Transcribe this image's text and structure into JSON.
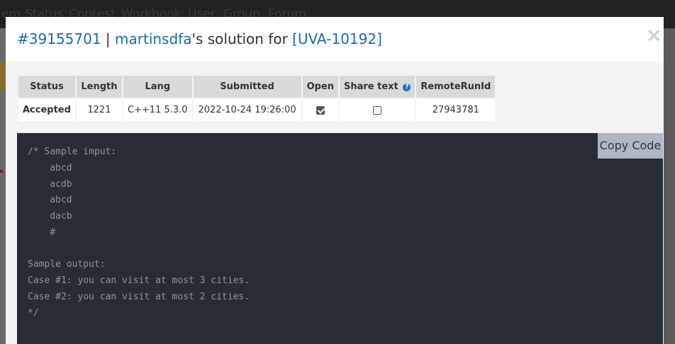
{
  "background_nav": {
    "items": [
      "em",
      "Status",
      "Contest",
      "Workbook",
      "User",
      "Group",
      "Forum"
    ]
  },
  "modal": {
    "run_id": "#39155701",
    "separator": " | ",
    "user": "martinsdfa",
    "middle_text": "'s solution for ",
    "problem": "[UVA-10192]",
    "close_symbol": "×"
  },
  "table": {
    "headers": {
      "status": "Status",
      "length": "Length",
      "lang": "Lang",
      "submitted": "Submitted",
      "open": "Open",
      "share_text": "Share text",
      "remote_run_id": "RemoteRunId"
    },
    "row": {
      "status": "Accepted",
      "length": "1221",
      "lang": "C++11 5.3.0",
      "submitted": "2022-10-24 19:26:00",
      "open_checked": true,
      "share_checked": false,
      "remote_run_id": "27943781"
    }
  },
  "code": {
    "copy_label": "Copy Code",
    "source": "/* Sample imput:\n    abcd\n    acdb\n    abcd\n    dacb\n    #\n\nSample output:\nCase #1: you can visit at most 3 cities.\nCase #2: you can visit at most 2 cities.\n*/"
  },
  "colors": {
    "link": "#1a6aa8",
    "accepted": "#4caf50",
    "code_bg": "#282c34"
  }
}
